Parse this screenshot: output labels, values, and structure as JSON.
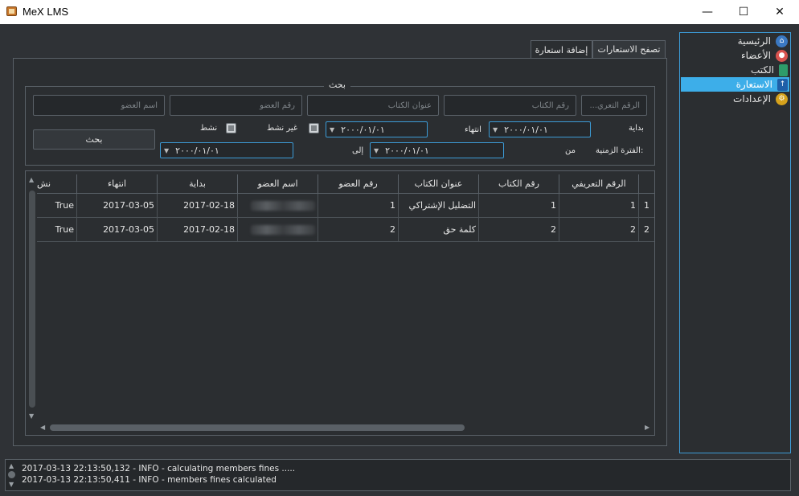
{
  "window": {
    "title": "MeX LMS",
    "minimize": "—",
    "maximize": "☐",
    "close": "✕"
  },
  "nav": {
    "items": [
      {
        "label": "الرئيسية",
        "icon": "home-icon",
        "color": "#3a78c2"
      },
      {
        "label": "الأعضاء",
        "icon": "member-icon",
        "color": "#d9534f"
      },
      {
        "label": "الكتب",
        "icon": "book-icon",
        "color": "#2e9c6a"
      },
      {
        "label": "الاستعارة",
        "icon": "borrow-icon",
        "color": "#1f5fa8",
        "active": true
      },
      {
        "label": "الإعدادات",
        "icon": "settings-icon",
        "color": "#d6a21c"
      }
    ]
  },
  "tabs": {
    "browse": "تصفح الاستعارات",
    "add": "إضافة استعارة"
  },
  "search": {
    "group_title": "بحث",
    "id_placeholder": "الرقم التعري...",
    "book_no_placeholder": "رقم الكتاب",
    "book_title_placeholder": "عنوان الكتاب",
    "member_no_placeholder": "رقم العضو",
    "member_name_placeholder": "اسم العضو",
    "start_label": "بداية",
    "end_label": "انتهاء",
    "inactive_label": "غير نشط",
    "active_label": "نشط",
    "period_label": "الفترة الزمنية:",
    "from_label": "من",
    "to_label": "إلى",
    "start_date": "٢٠٠٠/٠١/٠١",
    "end_date": "٢٠٠٠/٠١/٠١",
    "from_date": "٢٠٠٠/٠١/٠١",
    "to_date": "٢٠٠٠/٠١/٠١",
    "button": "بحث"
  },
  "table": {
    "headers": {
      "id": "الرقم التعريفي",
      "book_no": "رقم الكتاب",
      "book_title": "عنوان الكتاب",
      "member_no": "رقم العضو",
      "member_name": "اسم العضو",
      "start": "بداية",
      "end": "انتهاء",
      "active": "نش"
    },
    "rows": [
      {
        "row_no": "1",
        "id": "1",
        "book_no": "1",
        "book_title": "التضليل الإشتراكي",
        "member_no": "1",
        "start": "2017-02-18",
        "end": "2017-03-05",
        "active": "True"
      },
      {
        "row_no": "2",
        "id": "2",
        "book_no": "2",
        "book_title": "كلمة حق",
        "member_no": "2",
        "start": "2017-02-18",
        "end": "2017-03-05",
        "active": "True"
      }
    ]
  },
  "log": {
    "lines": [
      "2017-03-13 22:13:50,132 - INFO - calculating members fines .....",
      "2017-03-13 22:13:50,411 - INFO - members fines calculated"
    ]
  }
}
